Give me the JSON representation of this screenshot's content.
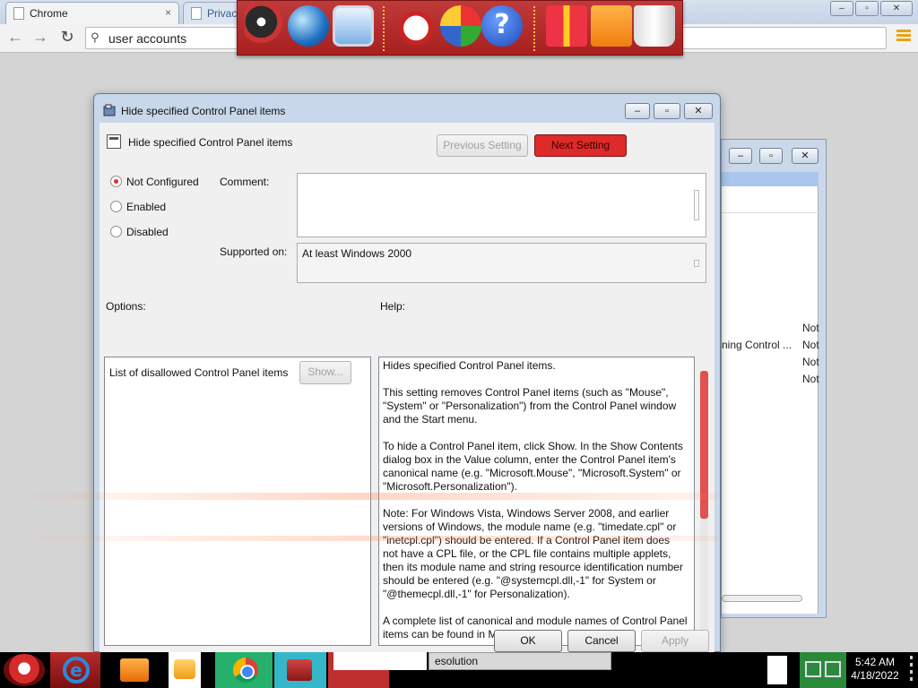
{
  "browser": {
    "tabs": [
      {
        "title": "Chrome",
        "close_glyph": "×"
      },
      {
        "title": "Privacy"
      }
    ],
    "nav": {
      "back_glyph": "←",
      "forward_glyph": "→",
      "reload_glyph": "↻"
    },
    "omnibox": {
      "search_glyph": "⚲",
      "value": "user accounts"
    },
    "window_controls": {
      "minimize": "–",
      "maximize": "▫",
      "close": "✕"
    },
    "menu_icon": "menu-icon",
    "accent_color": "#e8a317"
  },
  "dock": {
    "icons": [
      "computer-icon",
      "globe-icon",
      "display-icon",
      "snowman-icon",
      "security-shield-icon",
      "help-icon",
      "gift-icon",
      "folder-icon",
      "recycle-bin-icon"
    ],
    "help_glyph": "?",
    "background_color": "#b52828"
  },
  "background_window": {
    "rows": [
      {
        "name": "",
        "state": "Not"
      },
      {
        "name": "ning Control ...",
        "state": "Not"
      },
      {
        "name": "",
        "state": "Not"
      },
      {
        "name": "",
        "state": "Not"
      }
    ],
    "controls": {
      "minimize": "–",
      "maximize": "▫",
      "close": "✕"
    }
  },
  "dialog": {
    "title": "Hide specified Control Panel items",
    "title_controls": {
      "minimize": "–",
      "maximize": "▫",
      "close": "✕"
    },
    "setting_name": "Hide specified Control Panel items",
    "buttons": {
      "previous": "Previous Setting",
      "next": "Next Setting",
      "show": "Show...",
      "ok": "OK",
      "cancel": "Cancel",
      "apply": "Apply"
    },
    "radios": [
      {
        "label": "Not Configured",
        "selected": true
      },
      {
        "label": "Enabled",
        "selected": false
      },
      {
        "label": "Disabled",
        "selected": false
      }
    ],
    "comment_label": "Comment:",
    "comment_value": "",
    "supported_label": "Supported on:",
    "supported_value": "At least Windows 2000",
    "options_label": "Options:",
    "help_label": "Help:",
    "options_item": "List of disallowed Control Panel items",
    "help_paragraphs": [
      "Hides specified Control Panel items.",
      "This setting removes Control Panel items (such as \"Mouse\", \"System\" or \"Personalization\") from the Control Panel window and the Start menu.",
      "To hide a Control Panel item, click Show. In the Show Contents dialog box in the Value column, enter the Control Panel item's canonical name (e.g. \"Microsoft.Mouse\", \"Microsoft.System\" or \"Microsoft.Personalization\").",
      "Note: For Windows Vista, Windows Server 2008, and earlier versions of Windows, the module name (e.g. \"timedate.cpl\" or \"inetcpl.cpl\") should be entered. If a Control Panel item does not have a CPL file, or the CPL file contains multiple applets, then its module name and string resource identification number should be entered (e.g. \"@systemcpl.dll,-1\" for System or \"@themecpl.dll,-1\" for Personalization).",
      "A complete list of canonical and module names of Control Panel items can be found in MSDN at"
    ],
    "accent_color": "#dd2a2a"
  },
  "taskbar": {
    "items": [
      "start-orb-icon",
      "internet-explorer-icon",
      "folder-icon",
      "media-player-icon",
      "chrome-icon",
      "control-panel-icon"
    ],
    "ie_glyph": "e",
    "resolution_label": "esolution",
    "clock_time": "5:42 AM",
    "clock_date": "4/18/2022"
  }
}
